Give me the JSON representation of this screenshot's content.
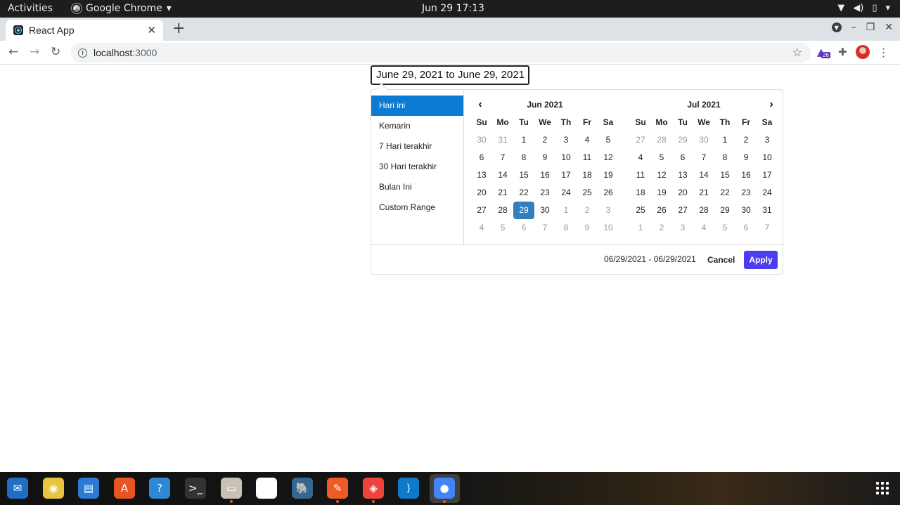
{
  "topbar": {
    "activities": "Activities",
    "app_name": "Google Chrome",
    "app_menu_arrow": "▾",
    "clock": "Jun 29  17:13",
    "tray": [
      "wifi-icon",
      "volume-icon",
      "battery-icon",
      "power-menu-arrow"
    ]
  },
  "browser": {
    "tab_title": "React App",
    "tab_close": "✕",
    "new_tab": "+",
    "window_controls": {
      "minimize": "–",
      "restore": "❐",
      "close": "✕"
    },
    "url_host": "localhost",
    "url_port": ":3000",
    "extension_badge": "26"
  },
  "page": {
    "range_input_value": "June 29, 2021 to June 29, 2021"
  },
  "picker": {
    "ranges": [
      {
        "label": "Hari ini",
        "active": true
      },
      {
        "label": "Kemarin",
        "active": false
      },
      {
        "label": "7 Hari terakhir",
        "active": false
      },
      {
        "label": "30 Hari terakhir",
        "active": false
      },
      {
        "label": "Bulan Ini",
        "active": false
      },
      {
        "label": "Custom Range",
        "active": false
      }
    ],
    "weekdays": [
      "Su",
      "Mo",
      "Tu",
      "We",
      "Th",
      "Fr",
      "Sa"
    ],
    "left_month": {
      "title": "Jun 2021",
      "days": [
        [
          "30",
          "off"
        ],
        [
          "31",
          "off"
        ],
        [
          "1",
          ""
        ],
        [
          "2",
          ""
        ],
        [
          "3",
          ""
        ],
        [
          "4",
          ""
        ],
        [
          "5",
          ""
        ],
        [
          "6",
          ""
        ],
        [
          "7",
          ""
        ],
        [
          "8",
          ""
        ],
        [
          "9",
          ""
        ],
        [
          "10",
          ""
        ],
        [
          "11",
          ""
        ],
        [
          "12",
          ""
        ],
        [
          "13",
          ""
        ],
        [
          "14",
          ""
        ],
        [
          "15",
          ""
        ],
        [
          "16",
          ""
        ],
        [
          "17",
          ""
        ],
        [
          "18",
          ""
        ],
        [
          "19",
          ""
        ],
        [
          "20",
          ""
        ],
        [
          "21",
          ""
        ],
        [
          "22",
          ""
        ],
        [
          "23",
          ""
        ],
        [
          "24",
          ""
        ],
        [
          "25",
          ""
        ],
        [
          "26",
          ""
        ],
        [
          "27",
          ""
        ],
        [
          "28",
          ""
        ],
        [
          "29",
          "sel"
        ],
        [
          "30",
          ""
        ],
        [
          "1",
          "off"
        ],
        [
          "2",
          "off"
        ],
        [
          "3",
          "off"
        ],
        [
          "4",
          "off"
        ],
        [
          "5",
          "off"
        ],
        [
          "6",
          "off"
        ],
        [
          "7",
          "off"
        ],
        [
          "8",
          "off"
        ],
        [
          "9",
          "off"
        ],
        [
          "10",
          "off"
        ]
      ]
    },
    "right_month": {
      "title": "Jul 2021",
      "days": [
        [
          "27",
          "off"
        ],
        [
          "28",
          "off"
        ],
        [
          "29",
          "off"
        ],
        [
          "30",
          "off"
        ],
        [
          "1",
          ""
        ],
        [
          "2",
          ""
        ],
        [
          "3",
          ""
        ],
        [
          "4",
          ""
        ],
        [
          "5",
          ""
        ],
        [
          "6",
          ""
        ],
        [
          "7",
          ""
        ],
        [
          "8",
          ""
        ],
        [
          "9",
          ""
        ],
        [
          "10",
          ""
        ],
        [
          "11",
          ""
        ],
        [
          "12",
          ""
        ],
        [
          "13",
          ""
        ],
        [
          "14",
          ""
        ],
        [
          "15",
          ""
        ],
        [
          "16",
          ""
        ],
        [
          "17",
          ""
        ],
        [
          "18",
          ""
        ],
        [
          "19",
          ""
        ],
        [
          "20",
          ""
        ],
        [
          "21",
          ""
        ],
        [
          "22",
          ""
        ],
        [
          "23",
          ""
        ],
        [
          "24",
          ""
        ],
        [
          "25",
          ""
        ],
        [
          "26",
          ""
        ],
        [
          "27",
          ""
        ],
        [
          "28",
          ""
        ],
        [
          "29",
          ""
        ],
        [
          "30",
          ""
        ],
        [
          "31",
          ""
        ],
        [
          "1",
          "off"
        ],
        [
          "2",
          "off"
        ],
        [
          "3",
          "off"
        ],
        [
          "4",
          "off"
        ],
        [
          "5",
          "off"
        ],
        [
          "6",
          "off"
        ],
        [
          "7",
          "off"
        ]
      ]
    },
    "selected_range_text": "06/29/2021 - 06/29/2021",
    "cancel_label": "Cancel",
    "apply_label": "Apply"
  },
  "dock": {
    "items": [
      {
        "name": "thunderbird-icon",
        "color": "#1f6fc5",
        "glyph": "✉",
        "running": false
      },
      {
        "name": "rhythmbox-icon",
        "color": "#e8c340",
        "glyph": "◉",
        "running": false
      },
      {
        "name": "writer-icon",
        "color": "#2a7ad6",
        "glyph": "▤",
        "running": false
      },
      {
        "name": "software-icon",
        "color": "#e95420",
        "glyph": "A",
        "running": false
      },
      {
        "name": "help-icon",
        "color": "#2d89d6",
        "glyph": "?",
        "running": false
      },
      {
        "name": "terminal-icon",
        "color": "#333333",
        "glyph": ">_",
        "running": false
      },
      {
        "name": "files-icon",
        "color": "#c8c2b4",
        "glyph": "▭",
        "running": true
      },
      {
        "name": "balsamiq-icon",
        "color": "#ffffff",
        "glyph": "◆",
        "running": false
      },
      {
        "name": "postgres-icon",
        "color": "#336791",
        "glyph": "🐘",
        "running": false
      },
      {
        "name": "postman-icon",
        "color": "#ef5b25",
        "glyph": "✎",
        "running": true
      },
      {
        "name": "anydesk-icon",
        "color": "#ef443b",
        "glyph": "◈",
        "running": true
      },
      {
        "name": "vscode-icon",
        "color": "#0f7acc",
        "glyph": "⟩",
        "running": false
      },
      {
        "name": "chrome-icon",
        "color": "#4285f4",
        "glyph": "●",
        "running": true
      }
    ]
  }
}
